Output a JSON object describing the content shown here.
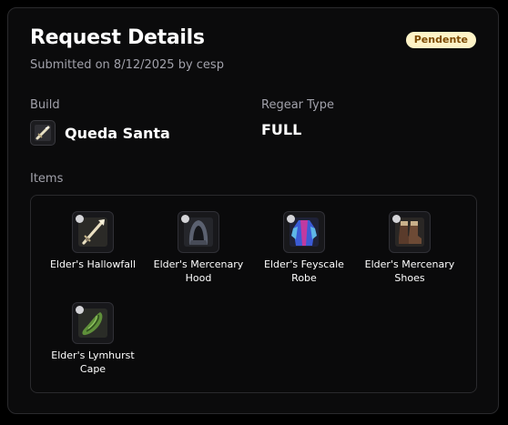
{
  "header": {
    "title": "Request Details",
    "subtitle": "Submitted on 8/12/2025 by cesp",
    "status": "Pendente",
    "status_color": "#fef3c7"
  },
  "build": {
    "label": "Build",
    "name": "Queda Santa",
    "icon": "sword-icon"
  },
  "regear": {
    "label": "Regear Type",
    "value": "FULL"
  },
  "items": {
    "label": "Items",
    "list": [
      {
        "name": "Elder's Hallowfall",
        "icon": "staff-icon"
      },
      {
        "name": "Elder's Mercenary Hood",
        "icon": "hood-icon"
      },
      {
        "name": "Elder's Feyscale Robe",
        "icon": "robe-icon"
      },
      {
        "name": "Elder's Mercenary Shoes",
        "icon": "shoes-icon"
      },
      {
        "name": "Elder's Lymhurst Cape",
        "icon": "cape-icon"
      }
    ]
  }
}
